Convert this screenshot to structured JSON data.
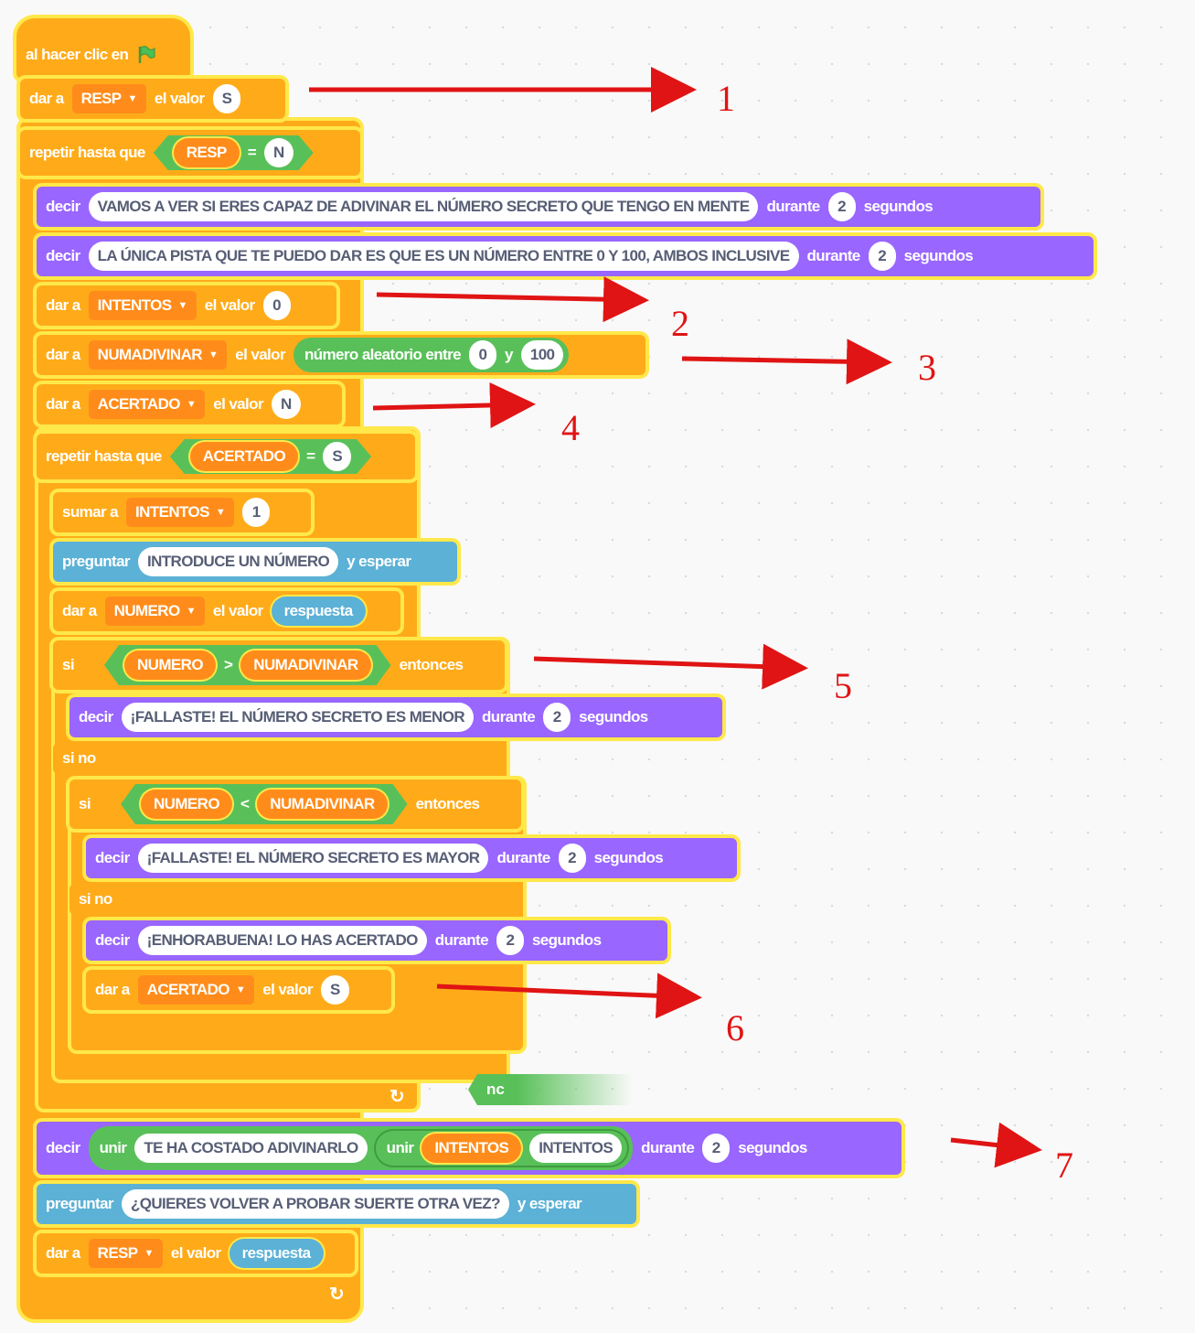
{
  "hat": {
    "label": "al hacer clic en"
  },
  "blocks": {
    "set_resp": {
      "label": "dar a",
      "var": "RESP",
      "mid": "el valor",
      "value": "S"
    },
    "repeat_outer": {
      "label": "repetir hasta que",
      "left": "RESP",
      "op": "=",
      "right": "N"
    },
    "say1": {
      "label": "decir",
      "text": "VAMOS A VER SI ERES CAPAZ DE ADIVINAR EL NÚMERO SECRETO QUE TENGO EN MENTE",
      "mid": "durante",
      "secs": "2",
      "unit": "segundos"
    },
    "say2": {
      "label": "decir",
      "text": "LA ÚNICA PISTA QUE TE PUEDO DAR ES QUE ES UN NÚMERO ENTRE 0 Y 100, AMBOS INCLUSIVE",
      "mid": "durante",
      "secs": "2",
      "unit": "segundos"
    },
    "set_intentos": {
      "label": "dar a",
      "var": "INTENTOS",
      "mid": "el valor",
      "value": "0"
    },
    "set_numadivinar": {
      "label": "dar a",
      "var": "NUMADIVINAR",
      "mid": "el valor",
      "random_label": "número aleatorio entre",
      "from": "0",
      "and": "y",
      "to": "100"
    },
    "set_acertado": {
      "label": "dar a",
      "var": "ACERTADO",
      "mid": "el valor",
      "value": "N"
    },
    "repeat_inner": {
      "label": "repetir hasta que",
      "left": "ACERTADO",
      "op": "=",
      "right": "S"
    },
    "change_intentos": {
      "label": "sumar a",
      "var": "INTENTOS",
      "value": "1"
    },
    "ask1": {
      "label": "preguntar",
      "text": "INTRODUCE UN NÚMERO",
      "tail": "y esperar"
    },
    "set_numero": {
      "label": "dar a",
      "var": "NUMERO",
      "mid": "el valor",
      "value": "respuesta"
    },
    "if1": {
      "label": "si",
      "left": "NUMERO",
      "op": ">",
      "right": "NUMADIVINAR",
      "tail": "entonces"
    },
    "say_menor": {
      "label": "decir",
      "text": "¡FALLASTE! EL NÚMERO SECRETO ES MENOR",
      "mid": "durante",
      "secs": "2",
      "unit": "segundos"
    },
    "else1": {
      "label": "si no"
    },
    "if2": {
      "label": "si",
      "left": "NUMERO",
      "op": "<",
      "right": "NUMADIVINAR",
      "tail": "entonces"
    },
    "say_mayor": {
      "label": "decir",
      "text": "¡FALLASTE! EL NÚMERO SECRETO ES MAYOR",
      "mid": "durante",
      "secs": "2",
      "unit": "segundos"
    },
    "else2": {
      "label": "si no"
    },
    "say_bien": {
      "label": "decir",
      "text": "¡ENHORABUENA! LO HAS ACERTADO",
      "mid": "durante",
      "secs": "2",
      "unit": "segundos"
    },
    "set_acertado_s": {
      "label": "dar a",
      "var": "ACERTADO",
      "mid": "el valor",
      "value": "S"
    },
    "stray": {
      "label": "nc"
    },
    "say_join": {
      "label": "decir",
      "join1": "unir",
      "text": "TE HA COSTADO ADIVINARLO",
      "join2": "unir",
      "var": "INTENTOS",
      "text2": "INTENTOS",
      "mid": "durante",
      "secs": "2",
      "unit": "segundos"
    },
    "ask2": {
      "label": "preguntar",
      "text": "¿QUIERES VOLVER A PROBAR SUERTE OTRA VEZ?",
      "tail": "y esperar"
    },
    "set_resp2": {
      "label": "dar a",
      "var": "RESP",
      "mid": "el valor",
      "value": "respuesta"
    }
  },
  "loop_glyph": "↻",
  "annotations": [
    "1",
    "2",
    "3",
    "4",
    "5",
    "6",
    "7"
  ],
  "colors": {
    "events": "#ffab19",
    "looks": "#9966ff",
    "sensing": "#5cb1d6",
    "operators": "#59c059",
    "variables": "#ff8c1a",
    "highlight": "#ffe84a",
    "annotation": "#e01414"
  }
}
